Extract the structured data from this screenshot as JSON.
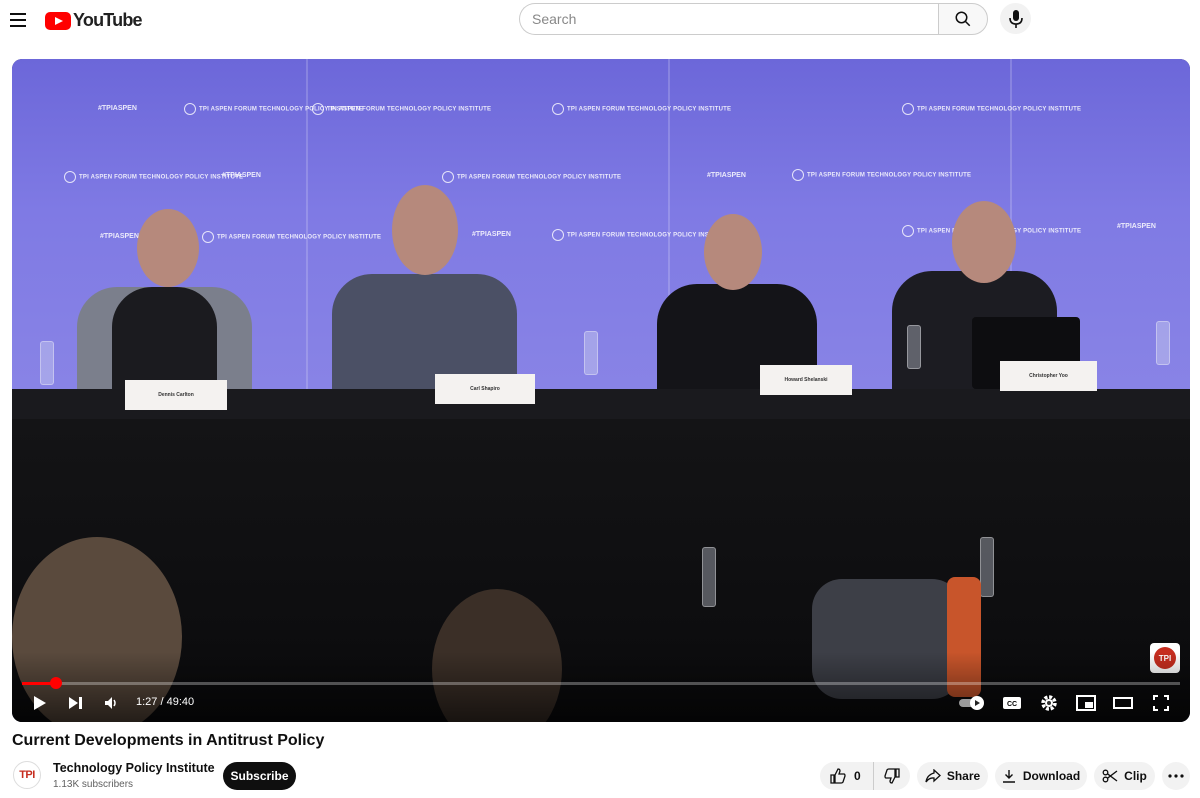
{
  "header": {
    "logo_text": "YouTube",
    "search_placeholder": "Search"
  },
  "player": {
    "current_time": "1:27",
    "duration": "49:40",
    "time_display": "1:27 / 49:40",
    "progress_fraction": 0.029,
    "watermark": "TPI",
    "scene": {
      "backdrop_text": "TPI ASPEN FORUM TECHNOLOGY POLICY INSTITUTE",
      "hashtag": "#TPIASPEN",
      "nameplates": [
        "Dennis Carlton",
        "Carl Shapiro",
        "Howard Shelanski",
        "Christopher Yoo"
      ]
    },
    "colors": {
      "progress": "#ff0000"
    }
  },
  "video": {
    "title": "Current Developments in Antitrust Policy",
    "channel_name": "Technology Policy Institute",
    "channel_avatar_text": "TPI",
    "subscribers": "1.13K subscribers",
    "subscribe_label": "Subscribe"
  },
  "actions": {
    "like_count": "0",
    "share_label": "Share",
    "download_label": "Download",
    "clip_label": "Clip"
  }
}
